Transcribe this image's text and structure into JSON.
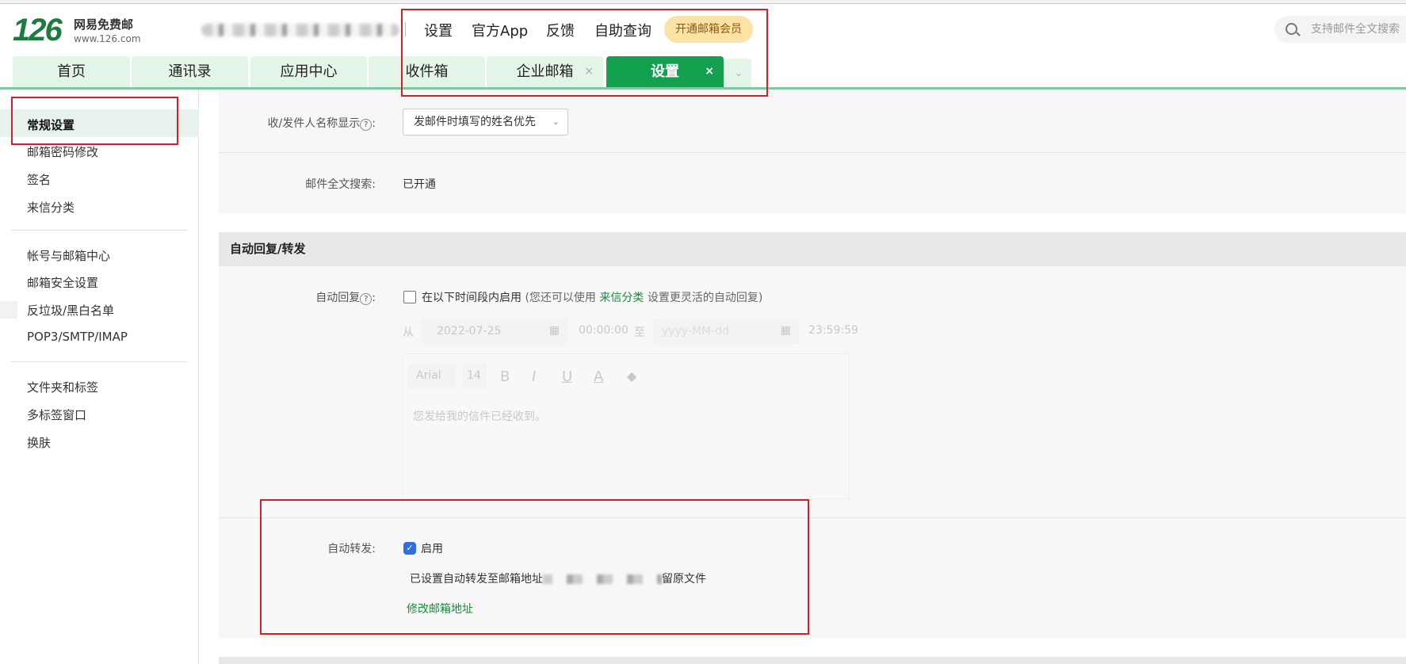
{
  "header": {
    "logo_number": "126",
    "logo_name": "网易免费邮",
    "logo_url": "www.126.com",
    "nav": [
      "设置",
      "官方App",
      "反馈",
      "自助查询"
    ],
    "vip_button": "开通邮箱会员",
    "search_placeholder": "支持邮件全文搜索"
  },
  "tabs": [
    {
      "label": "首页"
    },
    {
      "label": "通讯录"
    },
    {
      "label": "应用中心"
    },
    {
      "label": "收件箱"
    },
    {
      "label": "企业邮箱",
      "close": "×"
    },
    {
      "label": "设置",
      "close": "×",
      "active": true
    }
  ],
  "tab_more": "⌄",
  "sidebar": {
    "groups": [
      [
        "常规设置",
        "邮箱密码修改",
        "签名",
        "来信分类"
      ],
      [
        "帐号与邮箱中心",
        "邮箱安全设置",
        "反垃圾/黑白名单",
        "POP3/SMTP/IMAP"
      ],
      [
        "文件夹和标签",
        "多标签窗口",
        "换肤"
      ]
    ],
    "selected": "常规设置"
  },
  "general": {
    "name_display_label": "收/发件人名称显示",
    "name_display_value": "发邮件时填写的姓名优先",
    "fulltext_label": "邮件全文搜索:",
    "fulltext_value": "已开通"
  },
  "auto": {
    "section_title": "自动回复/转发",
    "reply_label": "自动回复",
    "reply_checkbox": "在以下时间段内启用",
    "reply_checked": false,
    "reply_hint_pre": "(您还可以使用",
    "reply_hint_link": "来信分类",
    "reply_hint_post": "设置更灵活的自动回复)",
    "from": "从",
    "start_date": "2022-07-25",
    "start_time": "00:00:00",
    "to": "至",
    "end_date_placeholder": "yyyy-MM-dd",
    "end_time": "23:59:59",
    "font": "Arial",
    "size": "14",
    "tools": [
      "B",
      "I",
      "U",
      "A"
    ],
    "reply_text": "您发给我的信件已经收到。",
    "forward_label": "自动转发:",
    "forward_checkbox": "启用",
    "forward_checked": true,
    "forward_info_pre": "已设置自动转发至邮箱地址",
    "forward_info_post": "留原文件",
    "forward_link": "修改邮箱地址"
  },
  "colors": {
    "brand": "#13a04f",
    "link": "#1a8a3d",
    "annotation": "#d0202a"
  }
}
